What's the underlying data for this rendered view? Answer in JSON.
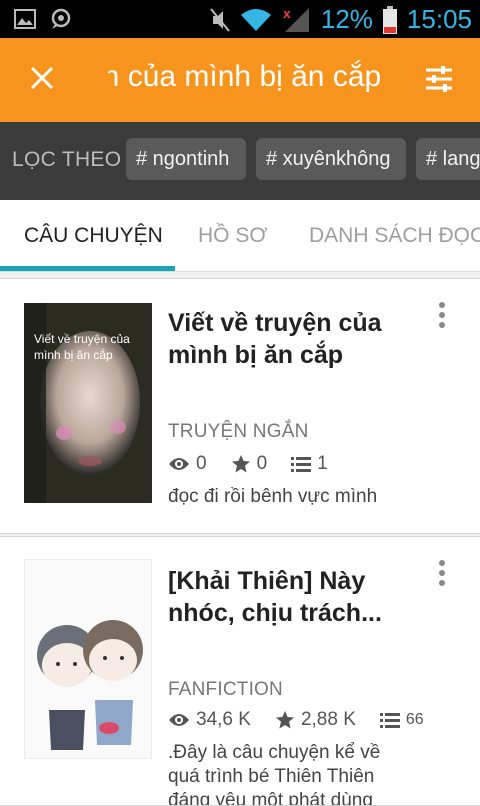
{
  "status_bar": {
    "battery_percent": "12%",
    "time": "15:05"
  },
  "search": {
    "query": "ện của mình bị ăn cắp"
  },
  "filter_bar": {
    "label": "LỌC THEO",
    "tags": [
      "# ngontinh",
      "# xuyênkhông",
      "# lang"
    ]
  },
  "tabs": [
    {
      "label": "CÂU CHUYỆN",
      "active": true
    },
    {
      "label": "HỒ SƠ",
      "active": false
    },
    {
      "label": "DANH SÁCH ĐỌC",
      "active": false
    }
  ],
  "stories": [
    {
      "cover_text": "Viết về truyện của mình bị ăn cắp",
      "title": "Viết về truyện của mình bị ăn cắp",
      "category": "TRUYỆN NGẮN",
      "reads": "0",
      "votes": "0",
      "parts": "1",
      "description": "đọc đi rồi bênh vực mình"
    },
    {
      "title": " [Khải Thiên] Này nhóc, chịu trách...",
      "category": "FANFICTION",
      "reads": "34,6 K",
      "votes": "2,88 K",
      "parts": "66",
      "description": ".Đây là câu chuyện kể về quá trình bé Thiên Thiên đáng yêu một phát dùng"
    }
  ],
  "colors": {
    "accent": "#f7941d",
    "tab_indicator": "#1aa6b7",
    "filter_bar": "#3b3b3b"
  }
}
